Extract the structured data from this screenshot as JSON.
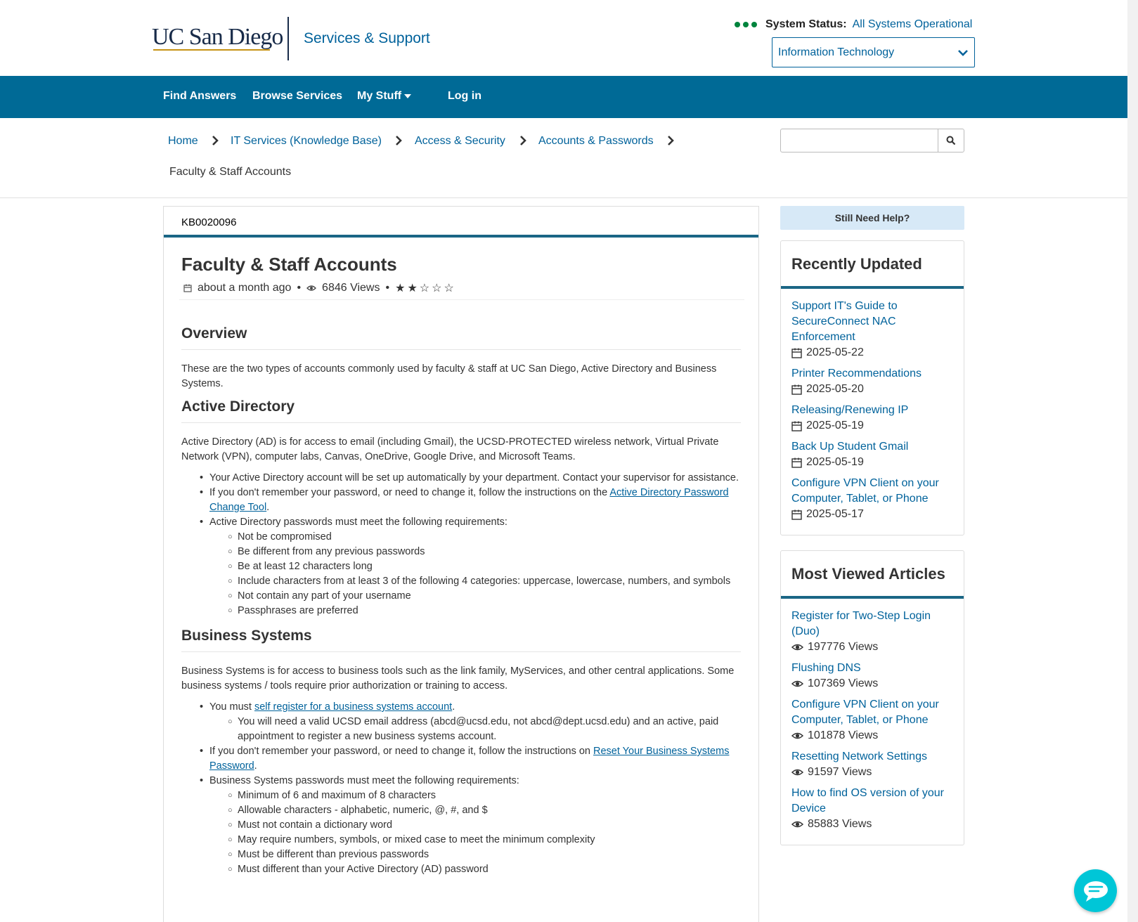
{
  "header": {
    "logo": "UC San Diego",
    "site_title": "Services & Support",
    "status_label": "System Status:",
    "status_value": "All Systems Operational",
    "department": "Information Technology"
  },
  "nav": {
    "find_answers": "Find Answers",
    "browse_services": "Browse Services",
    "my_stuff": "My Stuff",
    "login": "Log in"
  },
  "breadcrumb": {
    "items": [
      "Home",
      "IT Services (Knowledge Base)",
      "Access & Security",
      "Accounts & Passwords"
    ],
    "current": "Faculty & Staff Accounts"
  },
  "article": {
    "kb_number": "KB0020096",
    "title": "Faculty & Staff Accounts",
    "updated": "about a month ago",
    "views": "6846 Views",
    "rating": 2,
    "overview_heading": "Overview",
    "overview_text": "These are the two types of accounts commonly used by faculty & staff at UC San Diego, Active Directory and Business Systems.",
    "ad_heading": "Active Directory",
    "ad_text": "Active Directory (AD) is for access to email (including Gmail), the UCSD-PROTECTED wireless network, Virtual Private Network (VPN), computer labs, Canvas, OneDrive, Google Drive, and Microsoft Teams.",
    "ad_bullet1": "Your Active Directory account will be set up automatically by your department. Contact your supervisor for assistance.",
    "ad_bullet2_pre": "If you don't remember your password, or need to change it, follow the instructions on the ",
    "ad_bullet2_link": "Active Directory Password Change Tool",
    "ad_bullet2_post": ".",
    "ad_bullet3": "Active Directory passwords must meet the following requirements:",
    "ad_reqs": [
      "Not be compromised",
      "Be different from any previous passwords",
      "Be at least 12 characters long",
      "Include characters from at least 3 of the following 4 categories: uppercase, lowercase, numbers, and symbols",
      "Not contain any part of your username",
      "Passphrases are preferred"
    ],
    "bs_heading": "Business Systems",
    "bs_text": "Business Systems is for access to business tools such as the link family, MyServices, and other central applications. Some business systems / tools require prior authorization or training to access.",
    "bs_bullet1_pre": "You must ",
    "bs_bullet1_link": "self register for a business systems account",
    "bs_bullet1_post": ".",
    "bs_sub1": "You will need a valid UCSD email address (abcd@ucsd.edu, not abcd@dept.ucsd.edu) and an active, paid appointment to register a new business systems account.",
    "bs_bullet2_pre": "If you don't remember your password, or need to change it, follow the instructions on ",
    "bs_bullet2_link": "Reset Your Business Systems Password",
    "bs_bullet2_post": ".",
    "bs_bullet3": "Business Systems passwords must meet the following requirements:",
    "bs_reqs": [
      "Minimum of 6 and maximum of 8 characters",
      "Allowable characters - alphabetic, numeric, @, #, and $",
      "Must not contain a dictionary word",
      "May require numbers, symbols, or mixed case to meet the minimum complexity",
      "Must be different than previous passwords",
      "Must different than your Active Directory (AD) password"
    ]
  },
  "sidebar": {
    "help_button": "Still Need Help?",
    "recent_title": "Recently Updated",
    "recent": [
      {
        "title": "Support IT's Guide to SecureConnect NAC Enforcement",
        "date": "2025-05-22"
      },
      {
        "title": "Printer Recommendations",
        "date": "2025-05-20"
      },
      {
        "title": "Releasing/Renewing IP",
        "date": "2025-05-19"
      },
      {
        "title": "Back Up Student Gmail",
        "date": "2025-05-19"
      },
      {
        "title": "Configure VPN Client on your Computer, Tablet, or Phone",
        "date": "2025-05-17"
      }
    ],
    "viewed_title": "Most Viewed Articles",
    "viewed": [
      {
        "title": "Register for Two-Step Login (Duo)",
        "views": "197776 Views"
      },
      {
        "title": "Flushing DNS",
        "views": "107369 Views"
      },
      {
        "title": "Configure VPN Client on your Computer, Tablet, or Phone",
        "views": "101878 Views"
      },
      {
        "title": "Resetting Network Settings",
        "views": "91597 Views"
      },
      {
        "title": "How to find OS version of your Device",
        "views": "85883 Views"
      }
    ]
  },
  "icons": {
    "calendar": "calendar-icon",
    "eye": "eye-icon",
    "search": "search-icon",
    "chevron": "chevron-right-icon",
    "chat": "chat-icon"
  },
  "colors": {
    "brand_blue": "#006a96",
    "link": "#00629b",
    "status_green": "#00843d",
    "chat": "#00c6d7"
  }
}
